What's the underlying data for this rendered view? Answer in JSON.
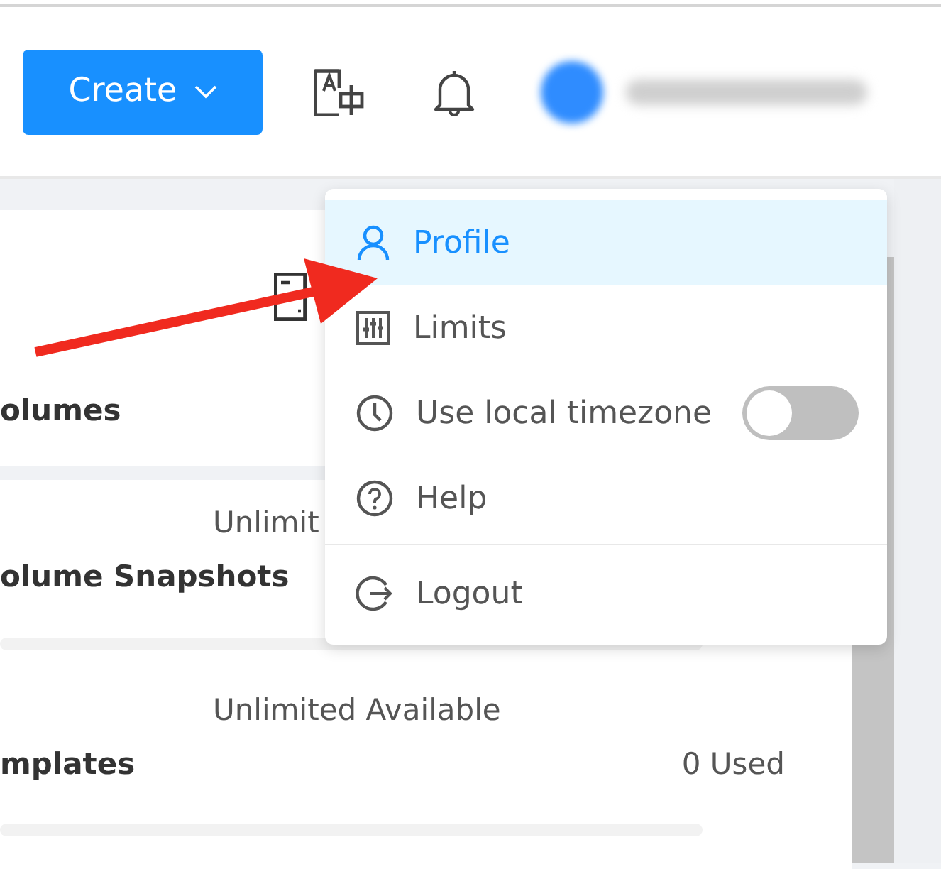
{
  "header": {
    "create_button": {
      "label": "Create"
    }
  },
  "quotas": [
    {
      "title": "olumes"
    },
    {
      "available": "Unlimit",
      "title": "olume Snapshots",
      "level": 0
    },
    {
      "available": "Unlimited Available",
      "title": "mplates",
      "used": "0 Used",
      "level": 0
    }
  ],
  "user_menu": {
    "items": [
      {
        "kind": "link",
        "label": "Profile",
        "selected": true
      },
      {
        "kind": "link",
        "label": "Limits",
        "selected": false
      },
      {
        "kind": "toggle",
        "label": "Use local timezone",
        "selected": false,
        "on": false
      },
      {
        "kind": "link",
        "label": "Help",
        "selected": false
      },
      {
        "kind": "link",
        "label": "Logout",
        "selected": false,
        "divider_before": true
      }
    ]
  }
}
